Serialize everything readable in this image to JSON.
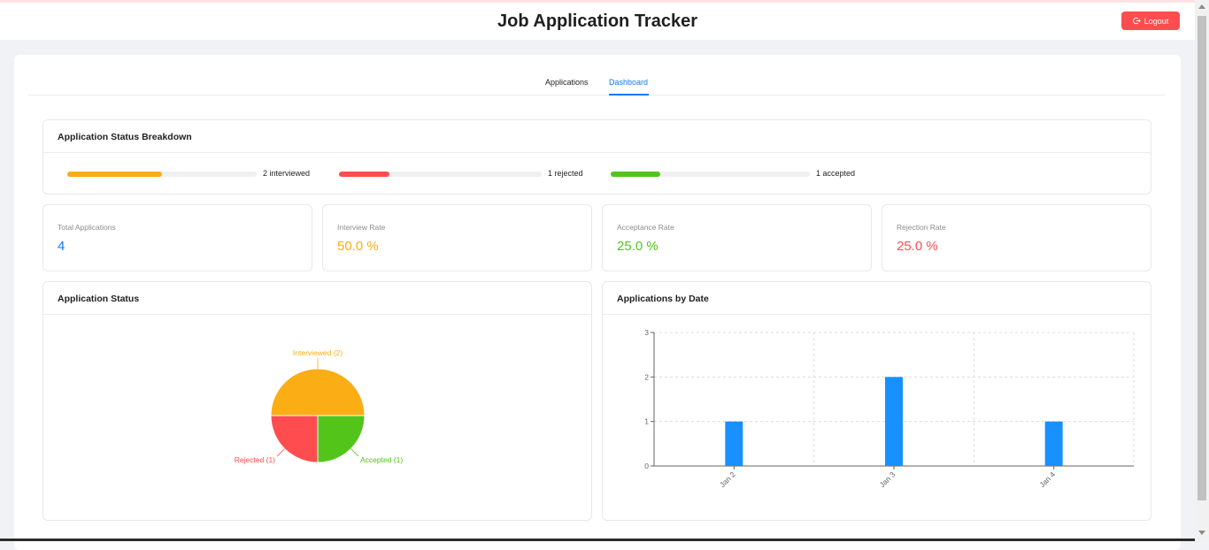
{
  "header": {
    "title": "Job Application Tracker",
    "logout_label": "Logout"
  },
  "tabs": [
    {
      "label": "Applications",
      "active": false
    },
    {
      "label": "Dashboard",
      "active": true
    }
  ],
  "status_breakdown": {
    "title": "Application Status Breakdown",
    "items": [
      {
        "label": "2 interviewed",
        "percent": 50,
        "color": "#faad14"
      },
      {
        "label": "1 rejected",
        "percent": 25,
        "color": "#ff4d4f"
      },
      {
        "label": "1 accepted",
        "percent": 25,
        "color": "#52c41a"
      }
    ]
  },
  "stats": [
    {
      "title": "Total Applications",
      "value": "4",
      "color": "#1677ff"
    },
    {
      "title": "Interview Rate",
      "value": "50.0 %",
      "color": "#faad14"
    },
    {
      "title": "Acceptance Rate",
      "value": "25.0 %",
      "color": "#52c41a"
    },
    {
      "title": "Rejection Rate",
      "value": "25.0 %",
      "color": "#ff4d4f"
    }
  ],
  "pie_card": {
    "title": "Application Status"
  },
  "bar_card": {
    "title": "Applications by Date"
  },
  "chart_data": [
    {
      "type": "pie",
      "slices": [
        {
          "label": "Interviewed (2)",
          "value": 2,
          "color": "#faad14"
        },
        {
          "label": "Accepted (1)",
          "value": 1,
          "color": "#52c41a"
        },
        {
          "label": "Rejected (1)",
          "value": 1,
          "color": "#ff4d4f"
        }
      ]
    },
    {
      "type": "bar",
      "categories": [
        "Jan 2",
        "Jan 3",
        "Jan 4"
      ],
      "values": [
        1,
        2,
        1
      ],
      "ylim": [
        0,
        3
      ],
      "yticks": [
        0,
        1,
        2,
        3
      ],
      "grid": true,
      "color": "#1890ff"
    }
  ]
}
